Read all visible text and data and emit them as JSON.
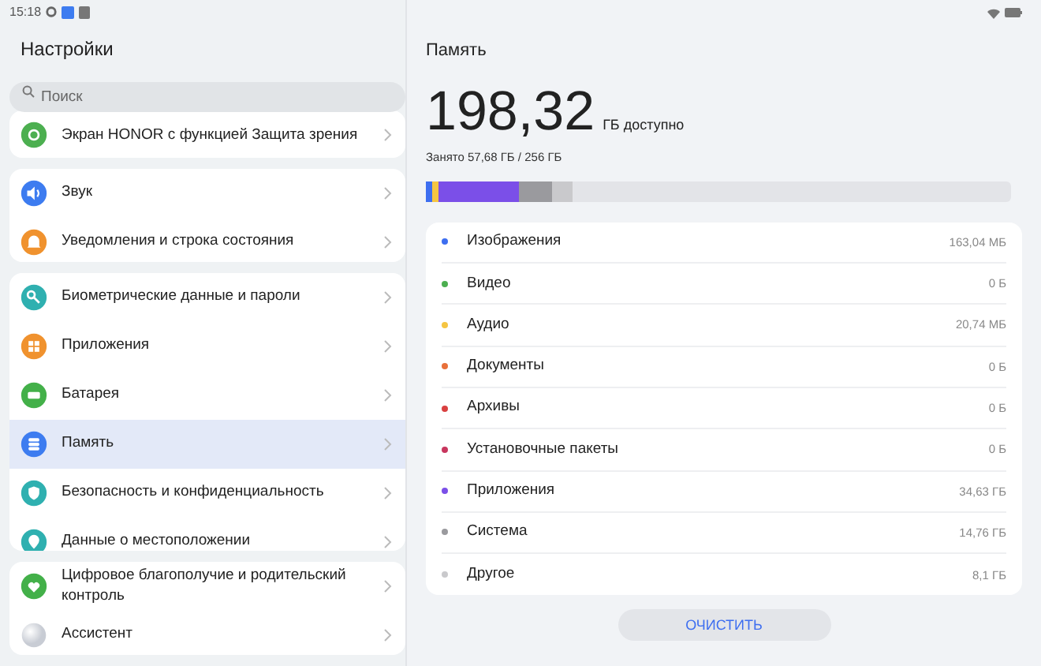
{
  "status_bar": {
    "time": "15:18"
  },
  "sidebar": {
    "title": "Настройки",
    "search": {
      "placeholder": "Поиск"
    },
    "groups": [
      {
        "items": [
          {
            "label": "Экран HONOR с функцией Защита зрения",
            "color": "#4caf50",
            "selected": false
          }
        ]
      },
      {
        "items": [
          {
            "label": "Звук",
            "color": "#3d7cf0",
            "selected": false
          },
          {
            "label": "Уведомления и строка состояния",
            "color": "#f0922e",
            "selected": false
          }
        ]
      },
      {
        "items": [
          {
            "label": "Биометрические данные и пароли",
            "color": "#2fb0b0",
            "selected": false
          },
          {
            "label": "Приложения",
            "color": "#f0922e",
            "selected": false
          },
          {
            "label": "Батарея",
            "color": "#43b049",
            "selected": false
          },
          {
            "label": "Память",
            "color": "#3d7cf0",
            "selected": true
          },
          {
            "label": "Безопасность и конфиденциальность",
            "color": "#2fb0b0",
            "selected": false
          },
          {
            "label": "Данные о местоположении",
            "color": "#2fb0b0",
            "selected": false
          }
        ]
      },
      {
        "items": [
          {
            "label": "Цифровое благополучие и родительский контроль",
            "color": "#43b049",
            "selected": false
          },
          {
            "label": "Ассистент",
            "color": "#c8ccd4",
            "selected": false
          }
        ]
      }
    ]
  },
  "content": {
    "title": "Память",
    "available_value": "198,32",
    "available_unit": "ГБ доступно",
    "used": "Занято 57,68 ГБ / 256 ГБ",
    "categories": [
      {
        "label": "Изображения",
        "size": "163,04 МБ",
        "color": "#3d6ef0"
      },
      {
        "label": "Видео",
        "size": "0 Б",
        "color": "#4caf50"
      },
      {
        "label": "Аудио",
        "size": "20,74 МБ",
        "color": "#f5c542"
      },
      {
        "label": "Документы",
        "size": "0 Б",
        "color": "#e8703a"
      },
      {
        "label": "Архивы",
        "size": "0 Б",
        "color": "#d94040"
      },
      {
        "label": "Установочные пакеты",
        "size": "0 Б",
        "color": "#c8365e"
      },
      {
        "label": "Приложения",
        "size": "34,63 ГБ",
        "color": "#7b4fe8"
      },
      {
        "label": "Система",
        "size": "14,76 ГБ",
        "color": "#9a9a9e"
      },
      {
        "label": "Другое",
        "size": "8,1 ГБ",
        "color": "#c9c9cc"
      }
    ],
    "button": "ОЧИСТИТЬ"
  }
}
